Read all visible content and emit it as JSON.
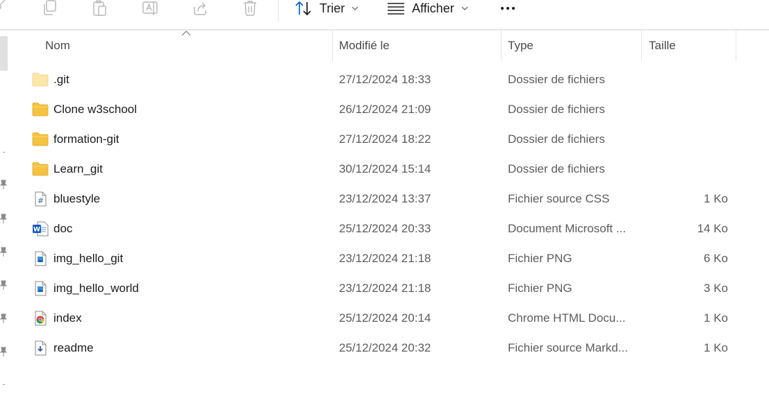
{
  "toolbar": {
    "icons": [
      "cut-icon",
      "copy-icon",
      "paste-icon",
      "rename-icon",
      "share-icon",
      "delete-icon"
    ],
    "sort_label": "Trier",
    "view_label": "Afficher",
    "more_label": "•••"
  },
  "columns": {
    "name": "Nom",
    "modified": "Modifié le",
    "type": "Type",
    "size": "Taille"
  },
  "files": [
    {
      "name": ".git",
      "modified": "27/12/2024 18:33",
      "type": "Dossier de fichiers",
      "size": "",
      "icon": "folder-light-icon"
    },
    {
      "name": "Clone w3school",
      "modified": "26/12/2024 21:09",
      "type": "Dossier de fichiers",
      "size": "",
      "icon": "folder-icon"
    },
    {
      "name": "formation-git",
      "modified": "27/12/2024 18:22",
      "type": "Dossier de fichiers",
      "size": "",
      "icon": "folder-icon"
    },
    {
      "name": "Learn_git",
      "modified": "30/12/2024 15:14",
      "type": "Dossier de fichiers",
      "size": "",
      "icon": "folder-icon"
    },
    {
      "name": "bluestyle",
      "modified": "23/12/2024 13:37",
      "type": "Fichier source CSS",
      "size": "1 Ko",
      "icon": "css-file-icon"
    },
    {
      "name": "doc",
      "modified": "25/12/2024 20:33",
      "type": "Document Microsoft ...",
      "size": "14 Ko",
      "icon": "word-document-icon"
    },
    {
      "name": "img_hello_git",
      "modified": "23/12/2024 21:18",
      "type": "Fichier PNG",
      "size": "6 Ko",
      "icon": "image-file-icon"
    },
    {
      "name": "img_hello_world",
      "modified": "23/12/2024 21:18",
      "type": "Fichier PNG",
      "size": "3 Ko",
      "icon": "image-file-icon"
    },
    {
      "name": "index",
      "modified": "25/12/2024 20:14",
      "type": "Chrome HTML Docu...",
      "size": "1 Ko",
      "icon": "chrome-html-icon"
    },
    {
      "name": "readme",
      "modified": "25/12/2024 20:32",
      "type": "Fichier source Markd...",
      "size": "1 Ko",
      "icon": "markdown-file-icon"
    }
  ],
  "colors": {
    "folder": "#f5c342",
    "folder_light": "#fbe7a8",
    "word_blue": "#185abd",
    "accent_blue": "#0067c0"
  }
}
